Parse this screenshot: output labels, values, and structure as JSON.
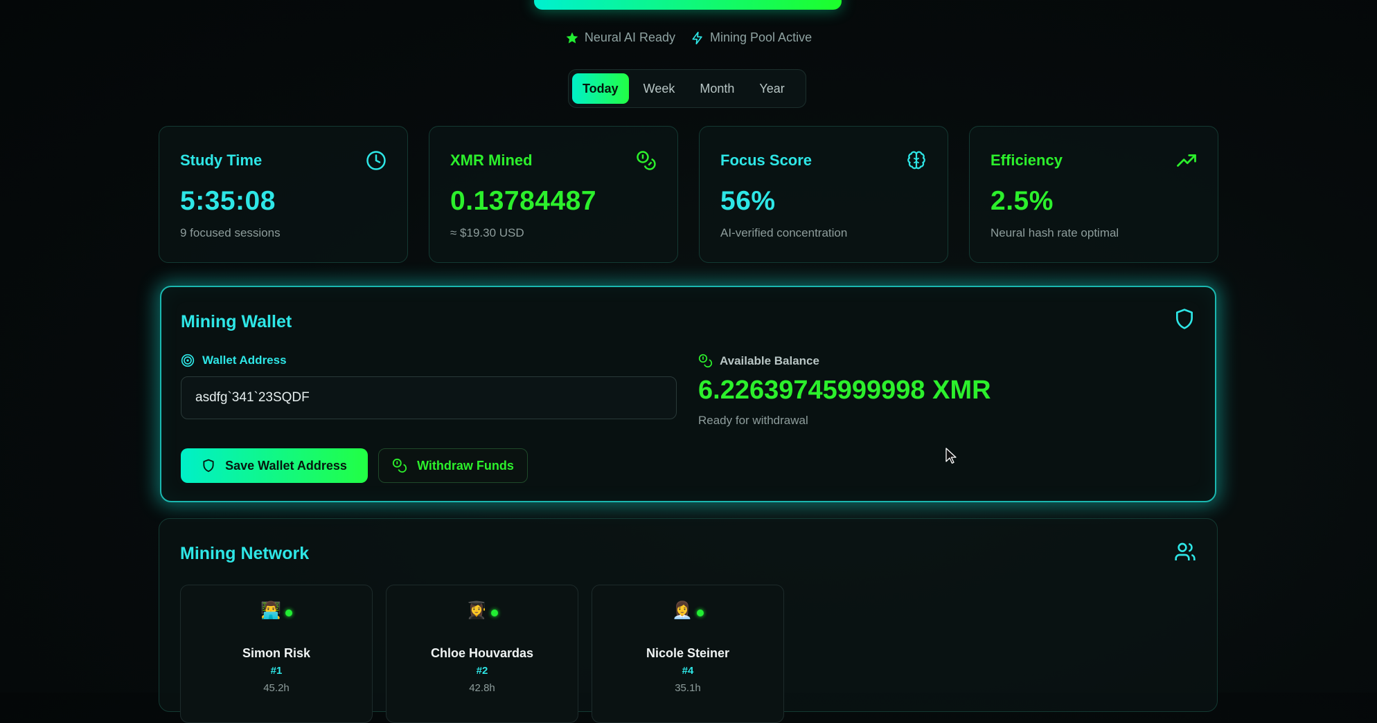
{
  "status": {
    "items": [
      {
        "label": "Neural AI Ready",
        "icon": "star-icon"
      },
      {
        "label": "Mining Pool Active",
        "icon": "lightning-icon"
      }
    ]
  },
  "period_tabs": {
    "tabs": [
      "Today",
      "Week",
      "Month",
      "Year"
    ],
    "active": "Today"
  },
  "stats": [
    {
      "title": "Study Time",
      "value": "5:35:08",
      "sub": "9 focused sessions",
      "icon": "clock-icon",
      "accent": "#2ee6e6"
    },
    {
      "title": "XMR Mined",
      "value": "0.13784487",
      "sub": "≈ $19.30 USD",
      "icon": "coins-icon",
      "accent": "#2cf02c"
    },
    {
      "title": "Focus Score",
      "value": "56%",
      "sub": "AI-verified concentration",
      "icon": "brain-icon",
      "accent": "#2ee6e6"
    },
    {
      "title": "Efficiency",
      "value": "2.5%",
      "sub": "Neural hash rate optimal",
      "icon": "trending-up-icon",
      "accent": "#2cf02c"
    }
  ],
  "wallet": {
    "heading": "Mining Wallet",
    "address_label": "Wallet Address",
    "address_value": "asdfg`341`23SQDF",
    "save_label": "Save Wallet Address",
    "withdraw_label": "Withdraw Funds",
    "balance_label": "Available Balance",
    "balance_value": "6.22639745999998 XMR",
    "balance_sub": "Ready for withdrawal"
  },
  "network": {
    "heading": "Mining Network",
    "miners": [
      {
        "avatar": "👨‍💻",
        "name": "Simon Risk",
        "rank": "#1",
        "hours": "45.2h"
      },
      {
        "avatar": "👩‍🎓",
        "name": "Chloe Houvardas",
        "rank": "#2",
        "hours": "42.8h"
      },
      {
        "avatar": "👩‍💼",
        "name": "Nicole Steiner",
        "rank": "#4",
        "hours": "35.1h"
      }
    ]
  },
  "colors": {
    "accent_cyan": "#2ee6e6",
    "accent_green": "#2cf02c",
    "background": "#050a0b"
  }
}
